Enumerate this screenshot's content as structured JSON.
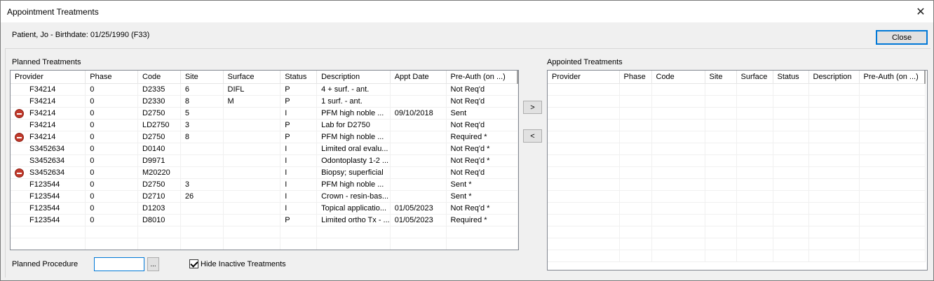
{
  "window": {
    "title": "Appointment Treatments",
    "close_glyph": "✕"
  },
  "patient_info": "Patient, Jo - Birthdate: 01/25/1990  (F33)",
  "close_button": "Close",
  "planned": {
    "label": "Planned Treatments",
    "columns": [
      "Provider",
      "Phase",
      "Code",
      "Site",
      "Surface",
      "Status",
      "Description",
      "Appt Date",
      "Pre-Auth (on ...)"
    ],
    "rows": [
      {
        "icon": "",
        "provider": "F34214",
        "phase": "0",
        "code": "D2335",
        "site": "6",
        "surface": "DIFL",
        "status": "P",
        "description": "4 + surf. - ant.",
        "appt_date": "",
        "preauth": "Not Req'd"
      },
      {
        "icon": "",
        "provider": "F34214",
        "phase": "0",
        "code": "D2330",
        "site": "8",
        "surface": "M",
        "status": "P",
        "description": "1 surf. - ant.",
        "appt_date": "",
        "preauth": "Not Req'd"
      },
      {
        "icon": "stop-icon",
        "provider": "F34214",
        "phase": "0",
        "code": "D2750",
        "site": "5",
        "surface": "",
        "status": "I",
        "description": "PFM high noble ...",
        "appt_date": "09/10/2018",
        "preauth": "Sent"
      },
      {
        "icon": "",
        "provider": "F34214",
        "phase": "0",
        "code": "LD2750",
        "site": "3",
        "surface": "",
        "status": "P",
        "description": "Lab for D2750",
        "appt_date": "",
        "preauth": "Not Req'd"
      },
      {
        "icon": "stop-icon",
        "provider": "F34214",
        "phase": "0",
        "code": "D2750",
        "site": "8",
        "surface": "",
        "status": "P",
        "description": "PFM high noble ...",
        "appt_date": "",
        "preauth": "Required *"
      },
      {
        "icon": "",
        "provider": "S3452634",
        "phase": "0",
        "code": "D0140",
        "site": "",
        "surface": "",
        "status": "I",
        "description": "Limited oral evalu...",
        "appt_date": "",
        "preauth": "Not Req'd *"
      },
      {
        "icon": "",
        "provider": "S3452634",
        "phase": "0",
        "code": "D9971",
        "site": "",
        "surface": "",
        "status": "I",
        "description": "Odontoplasty 1-2 ...",
        "appt_date": "",
        "preauth": "Not Req'd *"
      },
      {
        "icon": "stop-icon",
        "provider": "S3452634",
        "phase": "0",
        "code": "M20220",
        "site": "",
        "surface": "",
        "status": "I",
        "description": "Biopsy; superficial",
        "appt_date": "",
        "preauth": "Not Req'd"
      },
      {
        "icon": "",
        "provider": "F123544",
        "phase": "0",
        "code": "D2750",
        "site": "3",
        "surface": "",
        "status": "I",
        "description": "PFM high noble ...",
        "appt_date": "",
        "preauth": "Sent *"
      },
      {
        "icon": "",
        "provider": "F123544",
        "phase": "0",
        "code": "D2710",
        "site": "26",
        "surface": "",
        "status": "I",
        "description": "Crown - resin-bas...",
        "appt_date": "",
        "preauth": "Sent *"
      },
      {
        "icon": "",
        "provider": "F123544",
        "phase": "0",
        "code": "D1203",
        "site": "",
        "surface": "",
        "status": "I",
        "description": "Topical applicatio...",
        "appt_date": "01/05/2023",
        "preauth": "Not Req'd *"
      },
      {
        "icon": "",
        "provider": "F123544",
        "phase": "0",
        "code": "D8010",
        "site": "",
        "surface": "",
        "status": "P",
        "description": "Limited ortho Tx - ...",
        "appt_date": "01/05/2023",
        "preauth": "Required *"
      }
    ]
  },
  "appointed": {
    "label": "Appointed Treatments",
    "columns": [
      "Provider",
      "Phase",
      "Code",
      "Site",
      "Surface",
      "Status",
      "Description",
      "Pre-Auth (on ...)"
    ],
    "rows": []
  },
  "move_right_button": ">",
  "move_left_button": "<",
  "planned_procedure": {
    "label": "Planned Procedure",
    "value": "",
    "browse_button": "..."
  },
  "hide_inactive": {
    "label": "Hide Inactive Treatments",
    "checked": true
  }
}
